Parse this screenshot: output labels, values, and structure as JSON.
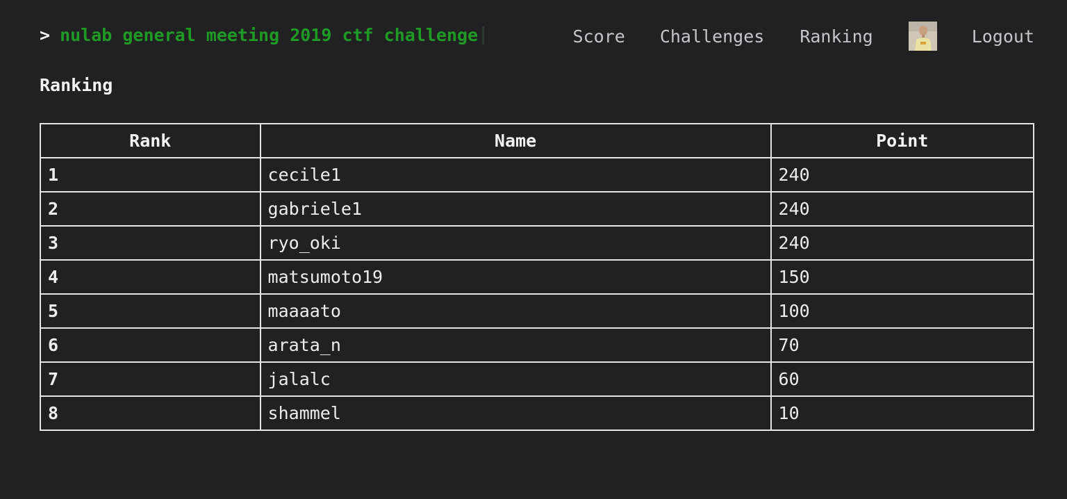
{
  "header": {
    "prompt": ">",
    "brand": "nulab general meeting 2019 ctf challenge",
    "nav": {
      "score": "Score",
      "challenges": "Challenges",
      "ranking": "Ranking",
      "logout": "Logout"
    },
    "avatar_icon": "user-avatar"
  },
  "page_title": "Ranking",
  "table": {
    "columns": [
      "Rank",
      "Name",
      "Point"
    ],
    "rows": [
      {
        "rank": "1",
        "name": "cecile1",
        "point": "240"
      },
      {
        "rank": "2",
        "name": "gabriele1",
        "point": "240"
      },
      {
        "rank": "3",
        "name": "ryo_oki",
        "point": "240"
      },
      {
        "rank": "4",
        "name": "matsumoto19",
        "point": "150"
      },
      {
        "rank": "5",
        "name": "maaaato",
        "point": "100"
      },
      {
        "rank": "6",
        "name": "arata_n",
        "point": "70"
      },
      {
        "rank": "7",
        "name": "jalalc",
        "point": "60"
      },
      {
        "rank": "8",
        "name": "shammel",
        "point": "10"
      }
    ]
  },
  "colors": {
    "background": "#212123",
    "brand_green": "#1f9b25",
    "nav_text": "#c4c6c9",
    "border": "#e6e6e6"
  }
}
